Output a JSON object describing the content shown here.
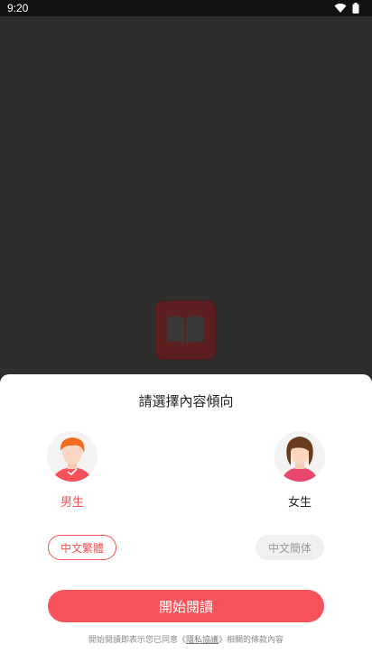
{
  "status_bar": {
    "time": "9:20",
    "icons": [
      "wifi-icon",
      "battery-icon"
    ]
  },
  "sheet": {
    "title": "請選擇內容傾向",
    "genders": [
      {
        "label": "男生",
        "selected": true
      },
      {
        "label": "女生",
        "selected": false
      }
    ],
    "languages": [
      {
        "label": "中文繁體",
        "selected": true
      },
      {
        "label": "中文簡体",
        "selected": false
      }
    ],
    "start_button": "開始閱讀",
    "terms": {
      "prefix": "開始閱讀即表示您已同意《",
      "link": "隱私協議",
      "suffix": "》相關的條款內容"
    }
  },
  "colors": {
    "accent": "#f5525a",
    "backdrop": "#2f2e2d"
  }
}
